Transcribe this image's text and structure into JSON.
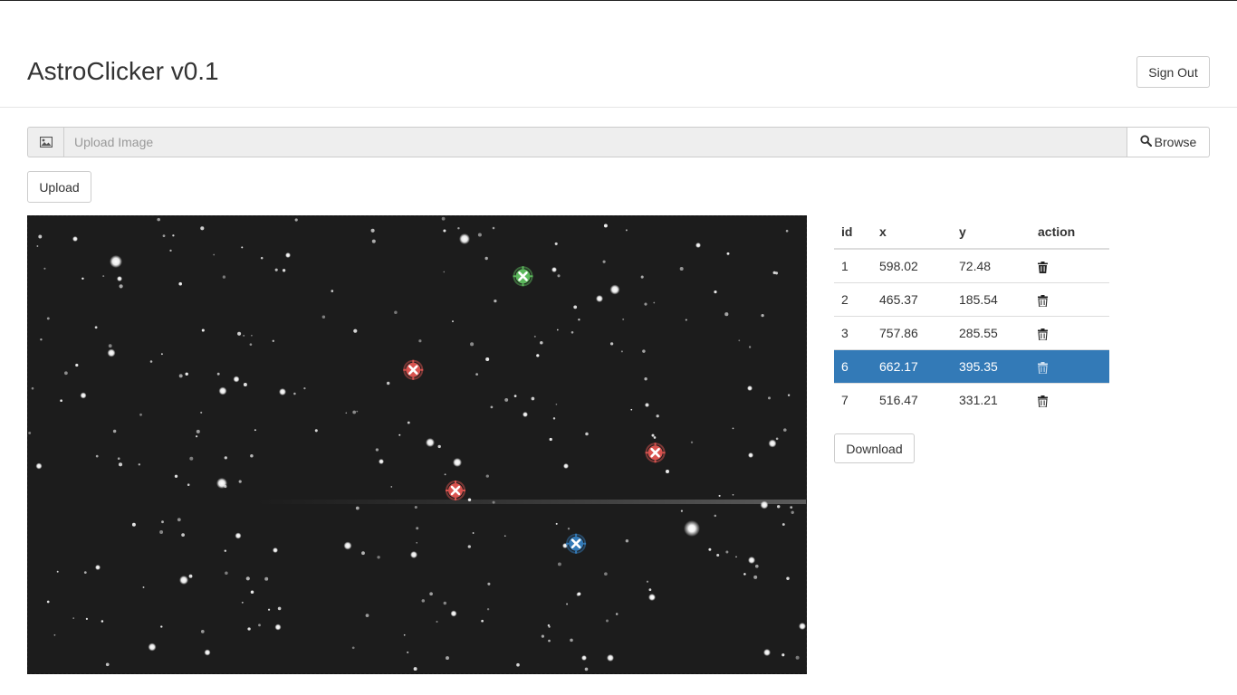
{
  "header": {
    "title": "AstroClicker v0.1",
    "sign_out_label": "Sign Out"
  },
  "upload": {
    "placeholder": "Upload Image",
    "browse_label": "Browse",
    "upload_label": "Upload"
  },
  "table": {
    "columns": [
      "id",
      "x",
      "y",
      "action"
    ],
    "rows": [
      {
        "id": "1",
        "x": "598.02",
        "y": "72.48"
      },
      {
        "id": "2",
        "x": "465.37",
        "y": "185.54"
      },
      {
        "id": "3",
        "x": "757.86",
        "y": "285.55"
      },
      {
        "id": "6",
        "x": "662.17",
        "y": "395.35"
      },
      {
        "id": "7",
        "x": "516.47",
        "y": "331.21"
      }
    ],
    "selected_row_id": "6",
    "selected_color": "#337ab7"
  },
  "download_label": "Download",
  "marker_colors": {
    "green": "#5cb85c",
    "red": "#d9534f",
    "blue": "#337ab7"
  },
  "icons": {
    "image_addon": "picture-icon",
    "browse": "search-icon",
    "row_action": "trash-icon",
    "marker": "crosshair-x-icon"
  }
}
